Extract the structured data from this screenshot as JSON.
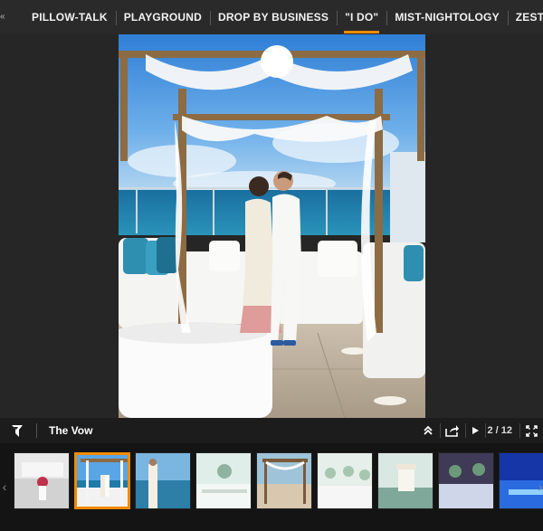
{
  "tabs": [
    {
      "label": "PILLOW-TALK",
      "active": false
    },
    {
      "label": "PLAYGROUND",
      "active": false
    },
    {
      "label": "DROP BY BUSINESS",
      "active": false
    },
    {
      "label": "\"I DO\"",
      "active": true
    },
    {
      "label": "MIST-NIGHTOLOGY",
      "active": false
    },
    {
      "label": "ZEST",
      "active": false
    }
  ],
  "tab_nav_prev_glyph": "«",
  "caption": {
    "title": "The Vow",
    "counter": "2 / 12"
  },
  "strip": {
    "prev_glyph": "‹",
    "next_glyph": "›",
    "active_index": 1,
    "count": 9
  },
  "colors": {
    "accent": "#f08a00",
    "bar_bg": "#2a2a2a",
    "caption_bg": "#1c1c1c",
    "strip_bg": "#141414"
  }
}
